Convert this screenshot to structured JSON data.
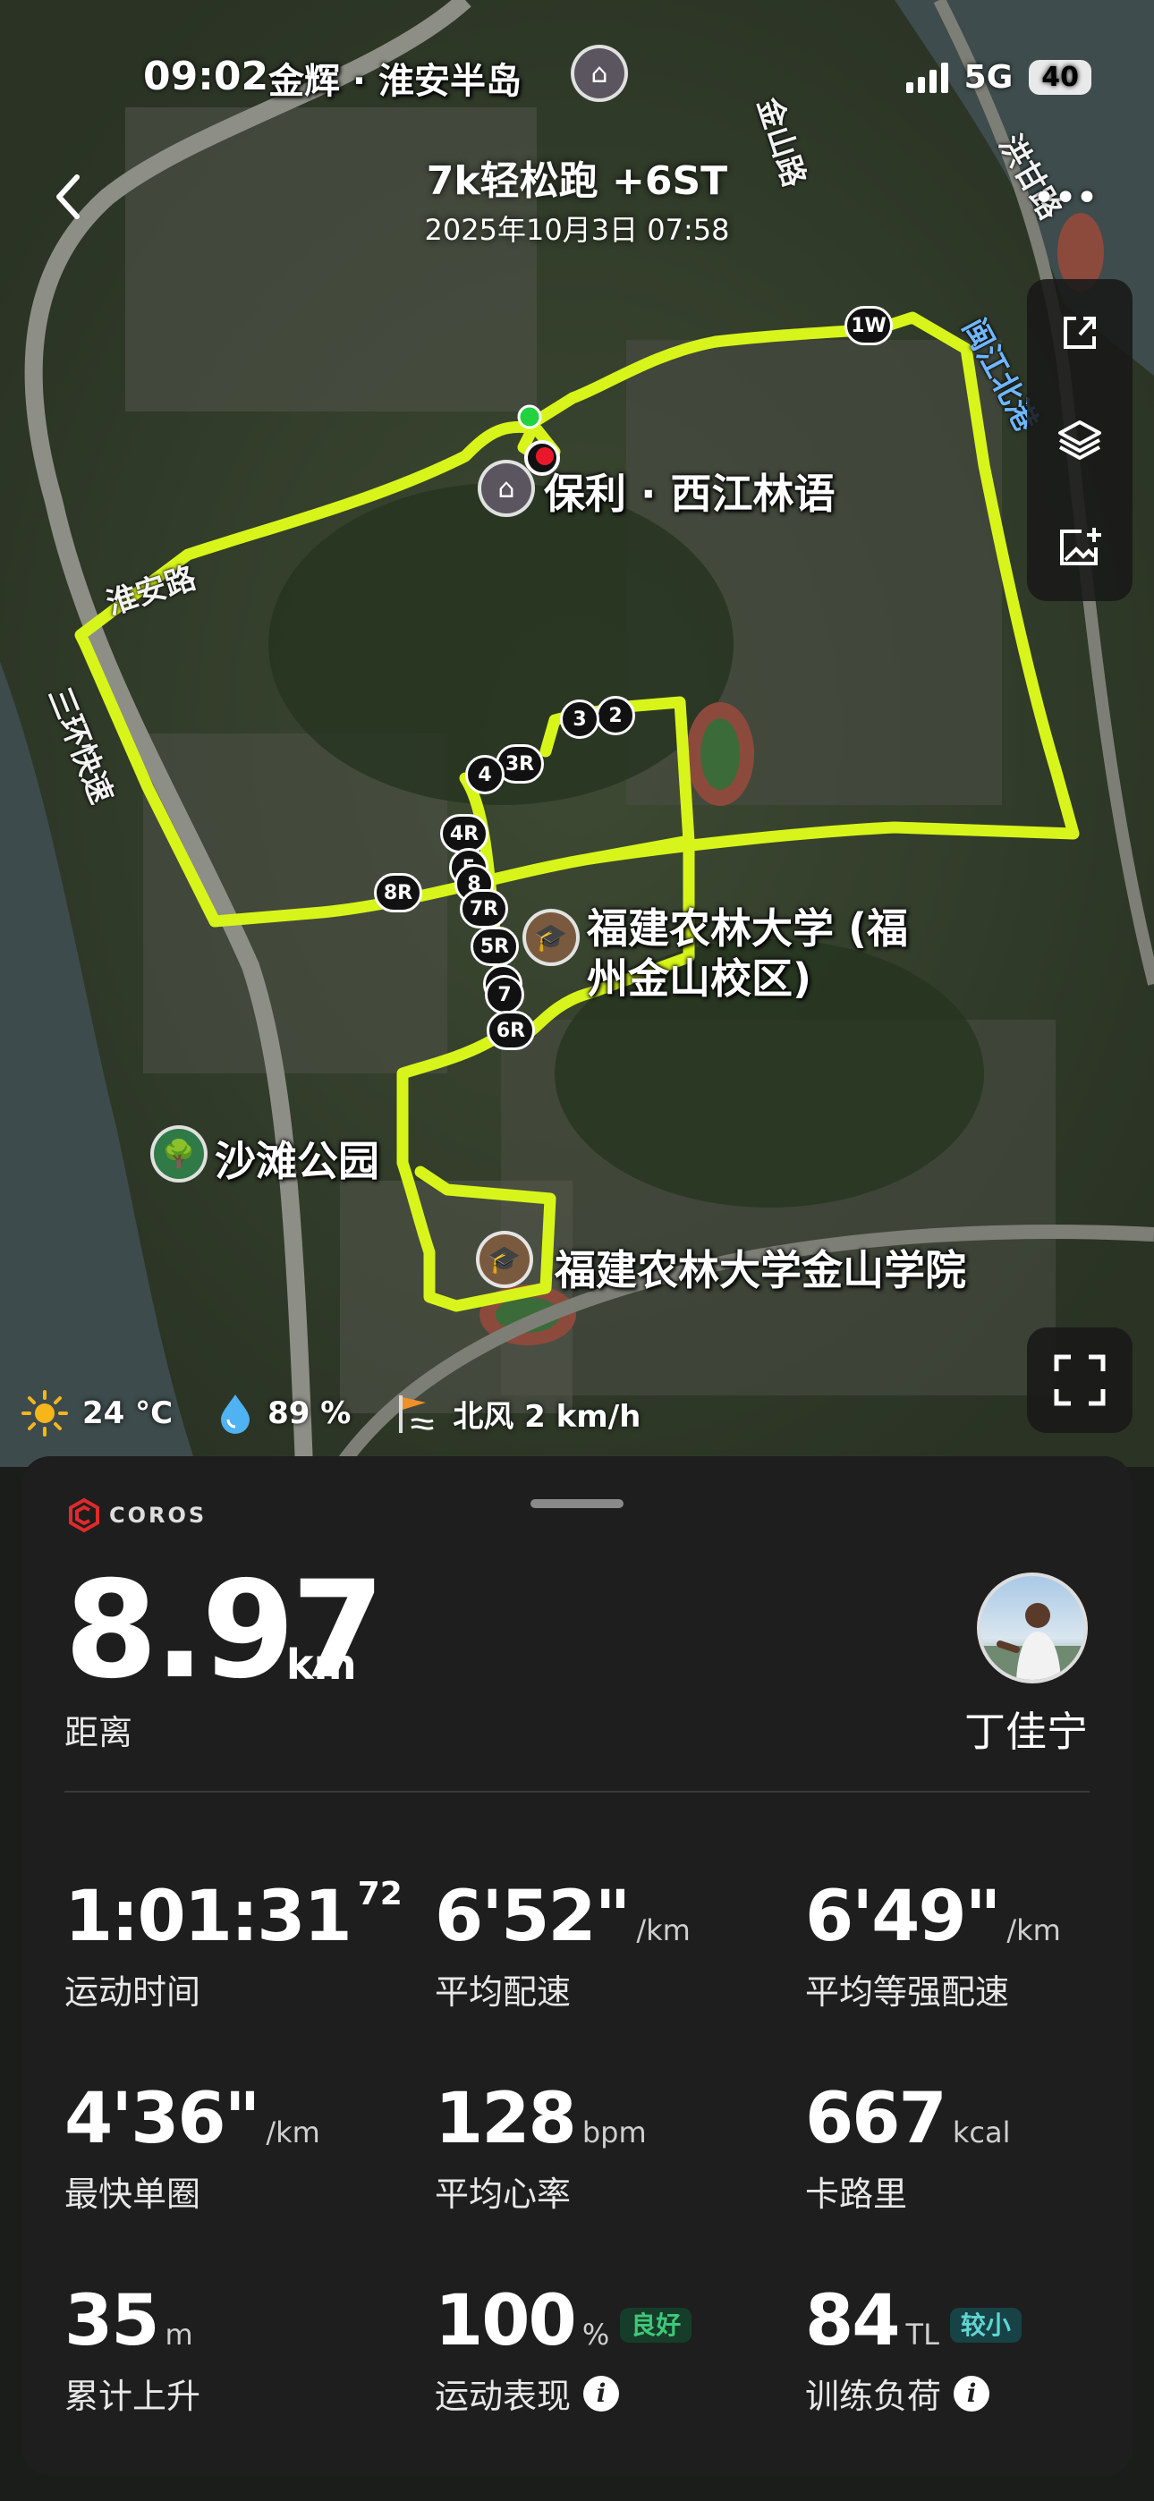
{
  "status_bar": {
    "time": "09:02",
    "network": "5G",
    "battery": "40"
  },
  "header": {
    "title": "7k轻松跑 +6ST",
    "subtitle": "2025年10月3日 07:58",
    "back_icon": "chevron-left-icon",
    "more_icon": "more-icon"
  },
  "map": {
    "places": {
      "top_place": "金辉 · 淮安半岛",
      "poly_xijiang": "保利 · 西江林语",
      "fafu_line1": "福建农林大学 (福",
      "fafu_line2": "州金山校区)",
      "fafu_jinshan": "福建农林大学金山学院",
      "beach_park": "沙滩公园"
    },
    "roads": {
      "jinshan_road": "金山路",
      "hongwan_road": "洪甘路",
      "minjiang_north": "闽江北港",
      "huaian_road": "淮安路",
      "ring_express": "三环快速"
    },
    "markers": [
      "1W",
      "2",
      "3",
      "3R",
      "4",
      "4R",
      "5",
      "8",
      "7R",
      "5R",
      "6",
      "7",
      "6R",
      "8R"
    ],
    "route_color": "#d7f51a"
  },
  "toolbar": {
    "share_icon": "share-icon",
    "layers_icon": "layers-icon",
    "add_photo_icon": "add-photo-icon",
    "fullscreen_icon": "fullscreen-icon"
  },
  "weather": {
    "temperature": "24 °C",
    "humidity": "89 %",
    "wind": "北风 2 km/h"
  },
  "summary": {
    "brand": "COROS",
    "distance_value": "8.97",
    "distance_unit": "km",
    "distance_label": "距离",
    "user_name": "丁佳宁"
  },
  "stats": [
    {
      "value": "1:01:31",
      "sup": "72",
      "unit": "",
      "label": "运动时间"
    },
    {
      "value": "6'52\"",
      "unit": "/km",
      "label": "平均配速"
    },
    {
      "value": "6'49\"",
      "unit": "/km",
      "label": "平均等强配速"
    },
    {
      "value": "4'36\"",
      "unit": "/km",
      "label": "最快单圈"
    },
    {
      "value": "128",
      "unit": "bpm",
      "label": "平均心率"
    },
    {
      "value": "667",
      "unit": "kcal",
      "label": "卡路里"
    },
    {
      "value": "35",
      "unit": "m",
      "label": "累计上升"
    },
    {
      "value": "100",
      "unit": "%",
      "badge": "良好",
      "label": "运动表现"
    },
    {
      "value": "84",
      "unit": "TL",
      "badge": "较小",
      "label": "训练负荷"
    }
  ]
}
